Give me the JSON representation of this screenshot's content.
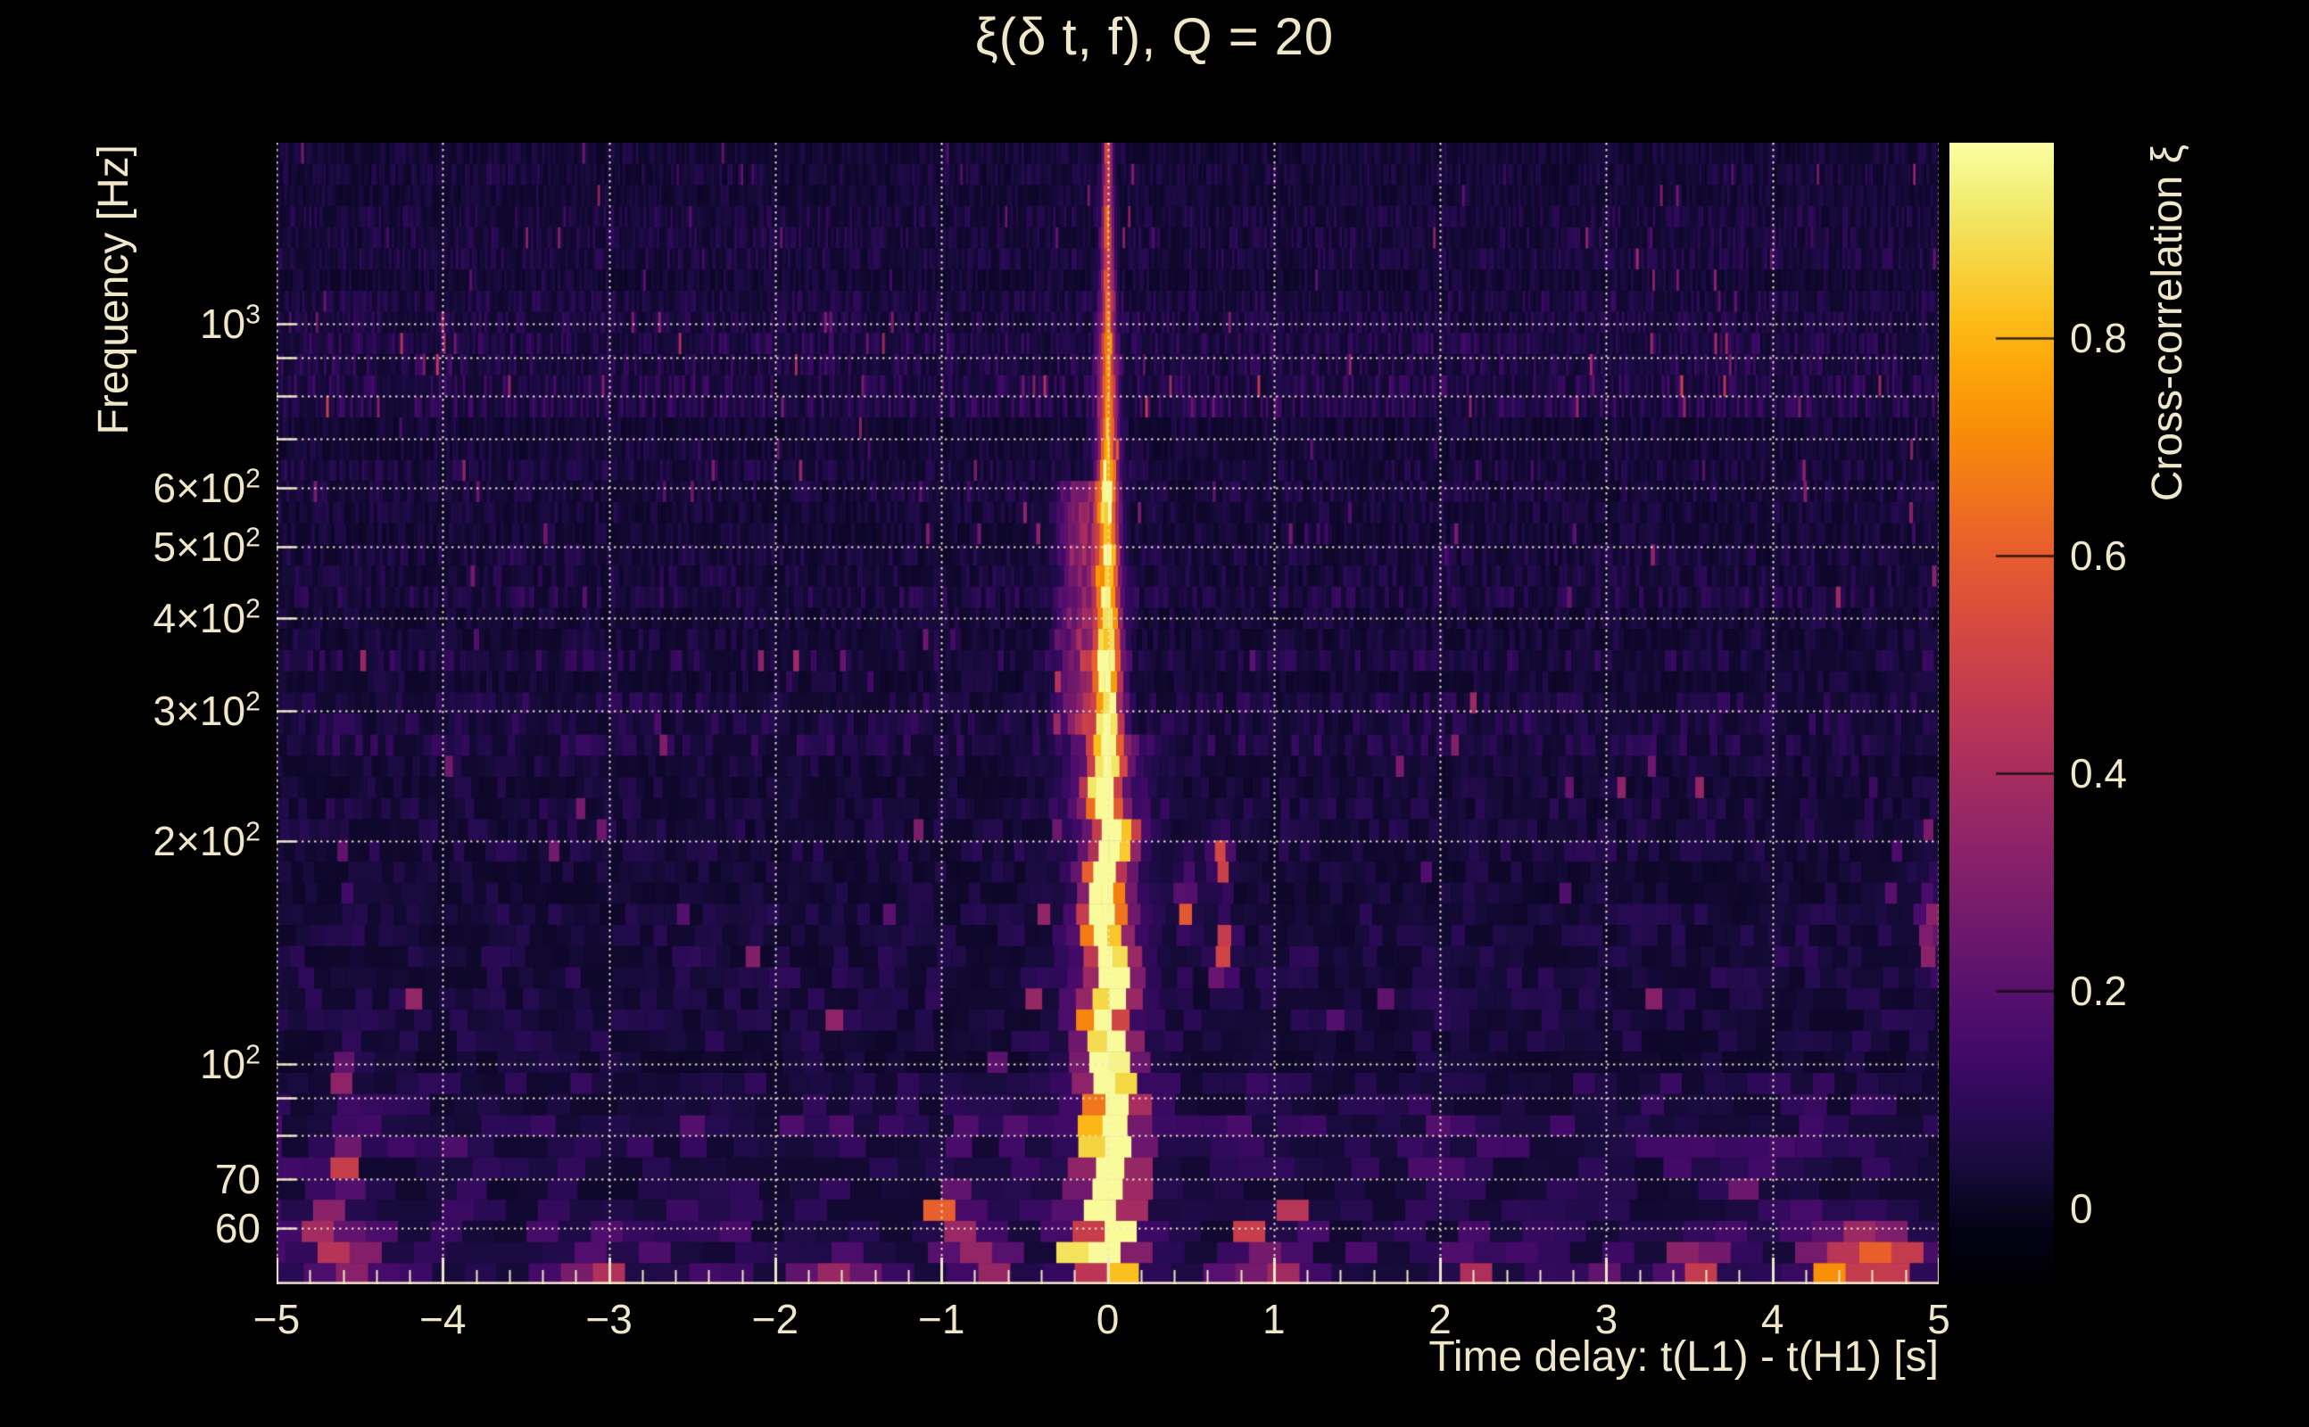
{
  "figure": {
    "background": "#000000",
    "text_color": "#f0e6c8",
    "grid_color": "#e8dfc0"
  },
  "chart_data": {
    "type": "heatmap",
    "title": "ξ(δ t, f), Q = 20",
    "xlabel": "Time delay: t(L1) - t(H1) [s]",
    "ylabel": "Frequency [Hz]",
    "colorbar_label": "Cross-correlation ξ",
    "x_range": [
      -5,
      5
    ],
    "x_ticks": [
      {
        "value": -5,
        "label": "−5"
      },
      {
        "value": -4,
        "label": "−4"
      },
      {
        "value": -3,
        "label": "−3"
      },
      {
        "value": -2,
        "label": "−2"
      },
      {
        "value": -1,
        "label": "−1"
      },
      {
        "value": 0,
        "label": "0"
      },
      {
        "value": 1,
        "label": "1"
      },
      {
        "value": 2,
        "label": "2"
      },
      {
        "value": 3,
        "label": "3"
      },
      {
        "value": 4,
        "label": "4"
      },
      {
        "value": 5,
        "label": "5"
      }
    ],
    "x_minor_step": 0.2,
    "y_scale": "log",
    "y_range_hz": [
      50.4,
      1757
    ],
    "y_ticks": [
      {
        "value": 1000,
        "base": "10",
        "exp": "3"
      },
      {
        "value": 600,
        "base": "6×10",
        "exp": "2"
      },
      {
        "value": 500,
        "base": "5×10",
        "exp": "2"
      },
      {
        "value": 400,
        "base": "4×10",
        "exp": "2"
      },
      {
        "value": 300,
        "base": "3×10",
        "exp": "2"
      },
      {
        "value": 200,
        "base": "2×10",
        "exp": "2"
      },
      {
        "value": 100,
        "base": "10",
        "exp": "2"
      },
      {
        "value": 70,
        "base": "70",
        "exp": ""
      },
      {
        "value": 60,
        "base": "60",
        "exp": ""
      }
    ],
    "y_gridlines_hz": [
      60,
      70,
      80,
      90,
      100,
      200,
      300,
      400,
      500,
      600,
      700,
      800,
      900,
      1000
    ],
    "grid": true,
    "colorbar_ticks": [
      0,
      0.2,
      0.4,
      0.6,
      0.8
    ],
    "color_range": [
      -0.07,
      0.98
    ],
    "colormap": "inferno",
    "colormap_stops": [
      [
        0.0,
        0,
        0,
        4
      ],
      [
        0.05,
        4,
        3,
        22
      ],
      [
        0.1,
        22,
        11,
        57
      ],
      [
        0.15,
        41,
        11,
        85
      ],
      [
        0.2,
        66,
        10,
        104
      ],
      [
        0.25,
        85,
        16,
        109
      ],
      [
        0.3,
        106,
        23,
        110
      ],
      [
        0.35,
        127,
        30,
        107
      ],
      [
        0.4,
        147,
        38,
        103
      ],
      [
        0.45,
        168,
        46,
        95
      ],
      [
        0.5,
        188,
        55,
        84
      ],
      [
        0.55,
        206,
        67,
        71
      ],
      [
        0.6,
        221,
        81,
        58
      ],
      [
        0.65,
        233,
        97,
        43
      ],
      [
        0.7,
        243,
        120,
        25
      ],
      [
        0.75,
        249,
        142,
        8
      ],
      [
        0.8,
        252,
        165,
        10
      ],
      [
        0.85,
        252,
        191,
        28
      ],
      [
        0.9,
        246,
        215,
        70
      ],
      [
        0.95,
        241,
        237,
        113
      ],
      [
        1.0,
        252,
        255,
        164
      ]
    ],
    "features": {
      "central_ridge": {
        "time_delay": 0,
        "sigma_t_top": 0.018,
        "sigma_t_bottom": 0.1,
        "wander_below_hz": 260,
        "wander_amp_s": 0.05,
        "amp_by_logf": [
          [
            3.25,
            0.5
          ],
          [
            3.05,
            0.55
          ],
          [
            2.9,
            0.7
          ],
          [
            2.75,
            0.85
          ],
          [
            2.6,
            0.8
          ],
          [
            2.45,
            0.95
          ],
          [
            2.25,
            1.0
          ],
          [
            2.05,
            1.05
          ],
          [
            1.9,
            1.1
          ],
          [
            1.78,
            0.95
          ],
          [
            1.7,
            0.85
          ]
        ],
        "left_wing": {
          "t": -0.15,
          "f_lo": 280,
          "f_hi": 620,
          "amp": 0.3,
          "sigma_t": 0.09
        },
        "halo": {
          "f_lo": 55,
          "f_hi": 280,
          "amp": 0.2,
          "sigma_t": 0.16
        }
      },
      "hotspots": [
        {
          "t": -4.63,
          "f": 73,
          "amp": 0.45,
          "st": 0.06,
          "slf": 0.03
        },
        {
          "t": -4.72,
          "f": 58,
          "amp": 0.4,
          "st": 0.07,
          "slf": 0.03
        },
        {
          "t": -4.6,
          "f": 95,
          "amp": 0.3,
          "st": 0.05,
          "slf": 0.025
        },
        {
          "t": -4.5,
          "f": 53,
          "amp": 0.3,
          "st": 0.1,
          "slf": 0.03
        },
        {
          "t": -3.1,
          "f": 51,
          "amp": 0.35,
          "st": 0.1,
          "slf": 0.03
        },
        {
          "t": -1.55,
          "f": 51,
          "amp": 0.3,
          "st": 0.08,
          "slf": 0.03
        },
        {
          "t": -0.95,
          "f": 62,
          "amp": 0.5,
          "st": 0.06,
          "slf": 0.03
        },
        {
          "t": -0.73,
          "f": 52,
          "amp": 0.45,
          "st": 0.08,
          "slf": 0.03
        },
        {
          "t": 0.47,
          "f": 165,
          "amp": 0.3,
          "st": 0.03,
          "slf": 0.03
        },
        {
          "t": 0.69,
          "f": 188,
          "amp": 0.5,
          "st": 0.035,
          "slf": 0.025
        },
        {
          "t": 0.7,
          "f": 140,
          "amp": 0.55,
          "st": 0.035,
          "slf": 0.03
        },
        {
          "t": 1.0,
          "f": 51,
          "amp": 0.35,
          "st": 0.1,
          "slf": 0.03
        },
        {
          "t": 2.2,
          "f": 52,
          "amp": 0.3,
          "st": 0.08,
          "slf": 0.03
        },
        {
          "t": 3.55,
          "f": 52,
          "amp": 0.5,
          "st": 0.1,
          "slf": 0.03
        },
        {
          "t": 4.35,
          "f": 53,
          "amp": 0.6,
          "st": 0.1,
          "slf": 0.035
        },
        {
          "t": 4.62,
          "f": 56,
          "amp": 0.45,
          "st": 0.08,
          "slf": 0.03
        },
        {
          "t": 4.78,
          "f": 54,
          "amp": 0.5,
          "st": 0.06,
          "slf": 0.03
        },
        {
          "t": 4.95,
          "f": 150,
          "amp": 0.4,
          "st": 0.04,
          "slf": 0.04
        }
      ],
      "noise_bands": [
        {
          "f_lo": 0,
          "f_hi": 53,
          "gain": 2.6
        },
        {
          "f_lo": 53,
          "f_hi": 63,
          "gain": 2.0
        },
        {
          "f_lo": 63,
          "f_hi": 95,
          "gain": 1.5
        },
        {
          "f_lo": 760,
          "f_hi": 980,
          "gain": 1.45
        },
        {
          "f_lo": 165,
          "f_hi": 225,
          "gain": 0.8
        }
      ],
      "seed": 150914
    }
  }
}
